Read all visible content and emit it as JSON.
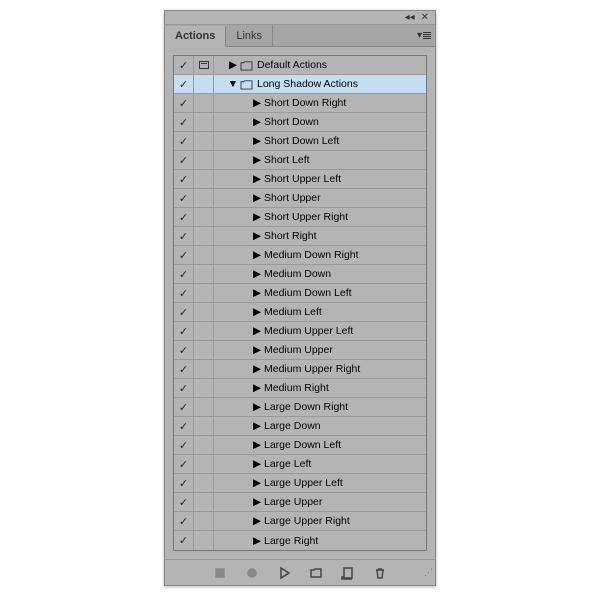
{
  "tabs": {
    "actions": "Actions",
    "links": "Links"
  },
  "sets": [
    {
      "name": "Default Actions",
      "expanded": false,
      "selected": false,
      "showDialog": true,
      "actions": []
    },
    {
      "name": "Long Shadow Actions",
      "expanded": true,
      "selected": true,
      "showDialog": false,
      "actions": [
        "Short Down Right",
        "Short Down",
        "Short Down Left",
        "Short Left",
        "Short Upper Left",
        "Short Upper",
        "Short Upper Right",
        "Short Right",
        "Medium Down Right",
        "Medium Down",
        "Medium Down Left",
        "Medium Left",
        "Medium Upper Left",
        "Medium Upper",
        "Medium Upper Right",
        "Medium Right",
        "Large Down Right",
        "Large Down",
        "Large Down Left",
        "Large Left",
        "Large Upper Left",
        "Large Upper",
        "Large Upper Right",
        "Large Right"
      ]
    }
  ],
  "footer": {
    "stop": "Stop",
    "record": "Record",
    "play": "Play",
    "newSet": "New Set",
    "newAction": "New Action",
    "delete": "Delete"
  }
}
